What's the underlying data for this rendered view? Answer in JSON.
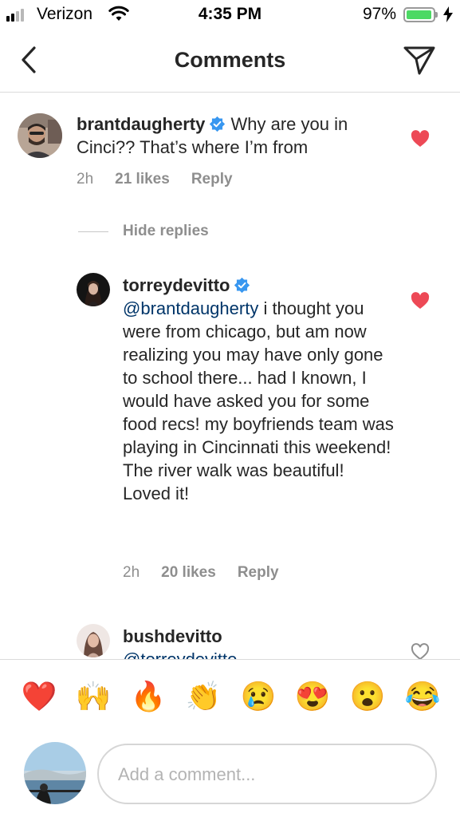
{
  "status_bar": {
    "carrier": "Verizon",
    "time": "4:35 PM",
    "battery_percent": "97%",
    "battery_level": 0.97
  },
  "nav": {
    "title": "Comments",
    "back_icon": "chevron-left-icon",
    "send_icon": "paper-plane-icon"
  },
  "comments": [
    {
      "username": "brantdaugherty",
      "verified": true,
      "text": "Why are you in Cinci?? That’s where I’m from",
      "time": "2h",
      "likes": "21 likes",
      "reply": "Reply",
      "liked": true
    }
  ],
  "hide_replies": "Hide replies",
  "replies": [
    {
      "username": "torreydevitto",
      "verified": true,
      "mention": "@brantdaugherty",
      "text": " i thought you were from chicago, but am now realizing you may have only gone to school there... had I known, I would have asked you for some food recs! my boyfriends team was playing in Cincinnati this weekend!  The river walk was beautiful! Loved it!",
      "time": "2h",
      "likes": "20 likes",
      "reply": "Reply",
      "liked": true
    },
    {
      "username": "bushdevitto",
      "verified": false,
      "mention": "@torreydevitto",
      "liked": false
    }
  ],
  "emojis": [
    "❤️",
    "🙌",
    "🔥",
    "👏",
    "😢",
    "😍",
    "😮",
    "😂"
  ],
  "input": {
    "placeholder": "Add a comment..."
  },
  "colors": {
    "heart_red": "#ed4956",
    "verified_blue": "#3897f0",
    "mention_blue": "#003569",
    "meta_gray": "#8e8e8e"
  }
}
